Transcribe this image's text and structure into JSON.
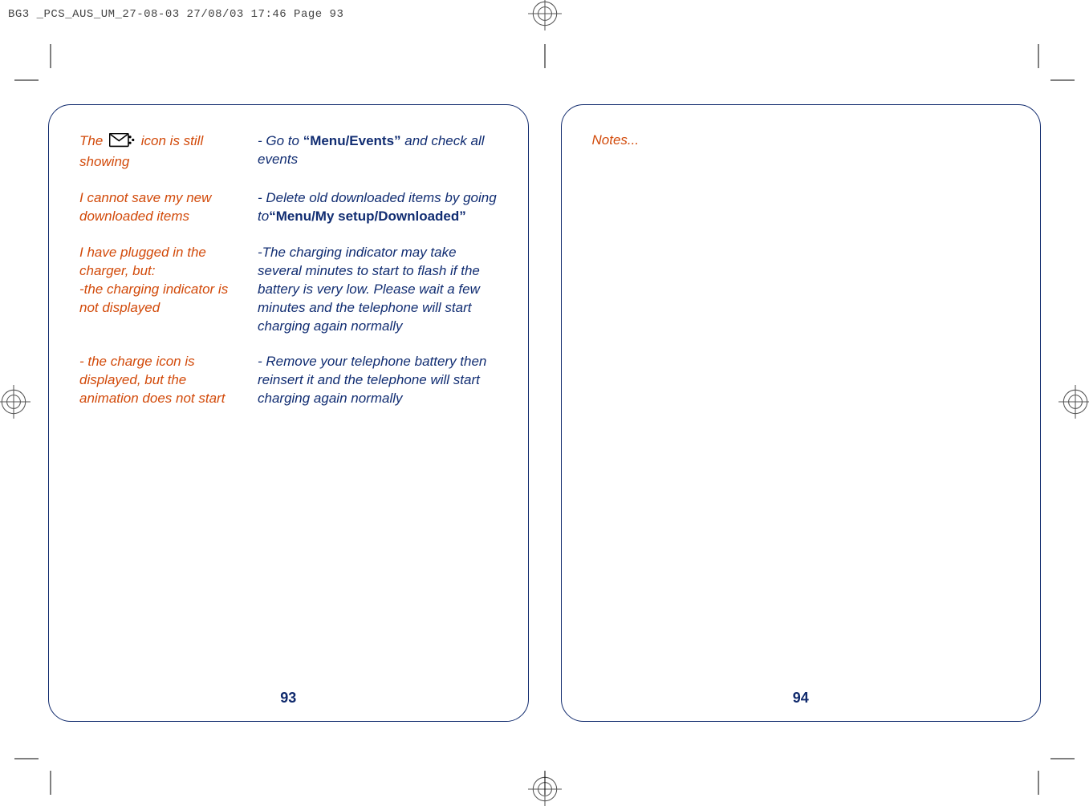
{
  "header": "BG3 _PCS_AUS_UM_27-08-03  27/08/03  17:46  Page 93",
  "page_left_number": "93",
  "page_right_number": "94",
  "notes_heading": "Notes...",
  "icon_alt": "message-event-envelope-icon",
  "rows": [
    {
      "problem_pre": "The ",
      "problem_post": " icon is still showing",
      "has_icon": true,
      "solution": "- Go to ",
      "solution_bold": "“Menu/Events”",
      "solution_after": " and check all events"
    },
    {
      "problem": "I cannot save my new downloaded items",
      "solution": "- Delete old downloaded items by going to",
      "solution_bold": "“Menu/My setup/Downloaded”",
      "solution_after": ""
    },
    {
      "problem": "I have plugged in the charger, but:\n-the charging indicator is not displayed",
      "solution": "-The charging indicator may take several minutes to start to flash if the battery is very low.  Please wait a few minutes and the telephone will start charging again normally"
    },
    {
      "problem": "- the charge icon is displayed, but the animation does not start",
      "solution": "- Remove your telephone battery then reinsert it and the telephone will start charging again normally"
    }
  ]
}
